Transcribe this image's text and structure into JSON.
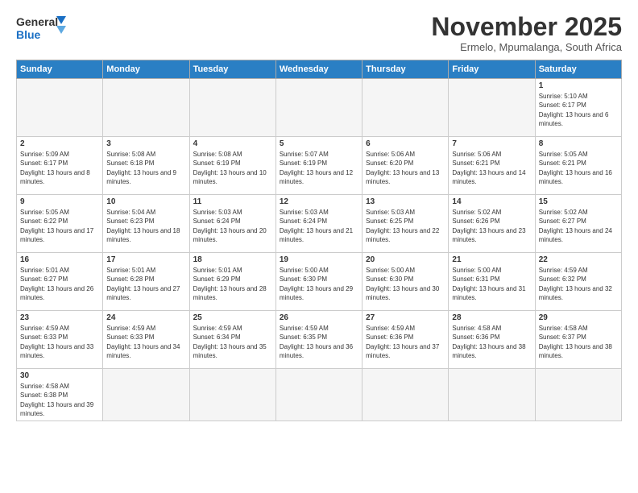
{
  "logo": {
    "line1": "General",
    "line2": "Blue"
  },
  "title": "November 2025",
  "subtitle": "Ermelo, Mpumalanga, South Africa",
  "weekdays": [
    "Sunday",
    "Monday",
    "Tuesday",
    "Wednesday",
    "Thursday",
    "Friday",
    "Saturday"
  ],
  "weeks": [
    [
      {
        "day": "",
        "info": ""
      },
      {
        "day": "",
        "info": ""
      },
      {
        "day": "",
        "info": ""
      },
      {
        "day": "",
        "info": ""
      },
      {
        "day": "",
        "info": ""
      },
      {
        "day": "",
        "info": ""
      },
      {
        "day": "1",
        "info": "Sunrise: 5:10 AM\nSunset: 6:17 PM\nDaylight: 13 hours and 6 minutes."
      }
    ],
    [
      {
        "day": "2",
        "info": "Sunrise: 5:09 AM\nSunset: 6:17 PM\nDaylight: 13 hours and 8 minutes."
      },
      {
        "day": "3",
        "info": "Sunrise: 5:08 AM\nSunset: 6:18 PM\nDaylight: 13 hours and 9 minutes."
      },
      {
        "day": "4",
        "info": "Sunrise: 5:08 AM\nSunset: 6:19 PM\nDaylight: 13 hours and 10 minutes."
      },
      {
        "day": "5",
        "info": "Sunrise: 5:07 AM\nSunset: 6:19 PM\nDaylight: 13 hours and 12 minutes."
      },
      {
        "day": "6",
        "info": "Sunrise: 5:06 AM\nSunset: 6:20 PM\nDaylight: 13 hours and 13 minutes."
      },
      {
        "day": "7",
        "info": "Sunrise: 5:06 AM\nSunset: 6:21 PM\nDaylight: 13 hours and 14 minutes."
      },
      {
        "day": "8",
        "info": "Sunrise: 5:05 AM\nSunset: 6:21 PM\nDaylight: 13 hours and 16 minutes."
      }
    ],
    [
      {
        "day": "9",
        "info": "Sunrise: 5:05 AM\nSunset: 6:22 PM\nDaylight: 13 hours and 17 minutes."
      },
      {
        "day": "10",
        "info": "Sunrise: 5:04 AM\nSunset: 6:23 PM\nDaylight: 13 hours and 18 minutes."
      },
      {
        "day": "11",
        "info": "Sunrise: 5:03 AM\nSunset: 6:24 PM\nDaylight: 13 hours and 20 minutes."
      },
      {
        "day": "12",
        "info": "Sunrise: 5:03 AM\nSunset: 6:24 PM\nDaylight: 13 hours and 21 minutes."
      },
      {
        "day": "13",
        "info": "Sunrise: 5:03 AM\nSunset: 6:25 PM\nDaylight: 13 hours and 22 minutes."
      },
      {
        "day": "14",
        "info": "Sunrise: 5:02 AM\nSunset: 6:26 PM\nDaylight: 13 hours and 23 minutes."
      },
      {
        "day": "15",
        "info": "Sunrise: 5:02 AM\nSunset: 6:27 PM\nDaylight: 13 hours and 24 minutes."
      }
    ],
    [
      {
        "day": "16",
        "info": "Sunrise: 5:01 AM\nSunset: 6:27 PM\nDaylight: 13 hours and 26 minutes."
      },
      {
        "day": "17",
        "info": "Sunrise: 5:01 AM\nSunset: 6:28 PM\nDaylight: 13 hours and 27 minutes."
      },
      {
        "day": "18",
        "info": "Sunrise: 5:01 AM\nSunset: 6:29 PM\nDaylight: 13 hours and 28 minutes."
      },
      {
        "day": "19",
        "info": "Sunrise: 5:00 AM\nSunset: 6:30 PM\nDaylight: 13 hours and 29 minutes."
      },
      {
        "day": "20",
        "info": "Sunrise: 5:00 AM\nSunset: 6:30 PM\nDaylight: 13 hours and 30 minutes."
      },
      {
        "day": "21",
        "info": "Sunrise: 5:00 AM\nSunset: 6:31 PM\nDaylight: 13 hours and 31 minutes."
      },
      {
        "day": "22",
        "info": "Sunrise: 4:59 AM\nSunset: 6:32 PM\nDaylight: 13 hours and 32 minutes."
      }
    ],
    [
      {
        "day": "23",
        "info": "Sunrise: 4:59 AM\nSunset: 6:33 PM\nDaylight: 13 hours and 33 minutes."
      },
      {
        "day": "24",
        "info": "Sunrise: 4:59 AM\nSunset: 6:33 PM\nDaylight: 13 hours and 34 minutes."
      },
      {
        "day": "25",
        "info": "Sunrise: 4:59 AM\nSunset: 6:34 PM\nDaylight: 13 hours and 35 minutes."
      },
      {
        "day": "26",
        "info": "Sunrise: 4:59 AM\nSunset: 6:35 PM\nDaylight: 13 hours and 36 minutes."
      },
      {
        "day": "27",
        "info": "Sunrise: 4:59 AM\nSunset: 6:36 PM\nDaylight: 13 hours and 37 minutes."
      },
      {
        "day": "28",
        "info": "Sunrise: 4:58 AM\nSunset: 6:36 PM\nDaylight: 13 hours and 38 minutes."
      },
      {
        "day": "29",
        "info": "Sunrise: 4:58 AM\nSunset: 6:37 PM\nDaylight: 13 hours and 38 minutes."
      }
    ],
    [
      {
        "day": "30",
        "info": "Sunrise: 4:58 AM\nSunset: 6:38 PM\nDaylight: 13 hours and 39 minutes."
      },
      {
        "day": "",
        "info": ""
      },
      {
        "day": "",
        "info": ""
      },
      {
        "day": "",
        "info": ""
      },
      {
        "day": "",
        "info": ""
      },
      {
        "day": "",
        "info": ""
      },
      {
        "day": "",
        "info": ""
      }
    ]
  ]
}
